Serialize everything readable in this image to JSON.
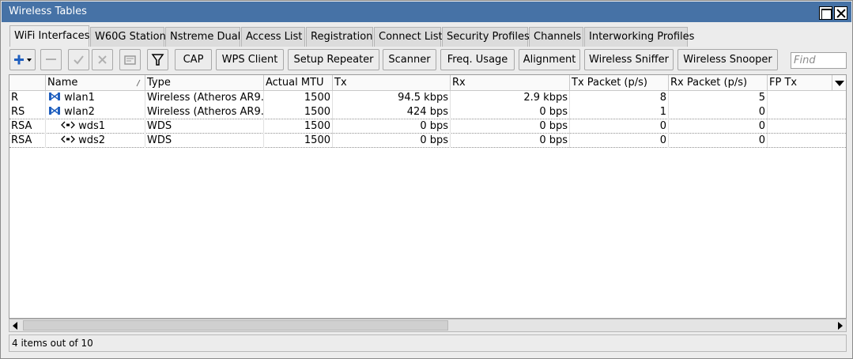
{
  "window": {
    "title": "Wireless Tables"
  },
  "tabs": [
    {
      "label": "WiFi Interfaces",
      "active": true
    },
    {
      "label": "W60G Station"
    },
    {
      "label": "Nstreme Dual"
    },
    {
      "label": "Access List"
    },
    {
      "label": "Registration"
    },
    {
      "label": "Connect List"
    },
    {
      "label": "Security Profiles"
    },
    {
      "label": "Channels"
    },
    {
      "label": "Interworking Profiles"
    }
  ],
  "toolbar": {
    "icons": {
      "add": "plus-icon",
      "remove": "minus-icon",
      "enable": "check-icon",
      "disable": "x-icon",
      "comment": "comment-icon",
      "filter": "filter-icon"
    },
    "buttons": [
      "CAP",
      "WPS Client",
      "Setup Repeater",
      "Scanner",
      "Freq. Usage",
      "Alignment",
      "Wireless Sniffer",
      "Wireless Snooper"
    ],
    "find_placeholder": "Find"
  },
  "table": {
    "columns": [
      "",
      "Name",
      "Type",
      "Actual MTU",
      "Tx",
      "Rx",
      "Tx Packet (p/s)",
      "Rx Packet (p/s)",
      "FP Tx"
    ],
    "rows": [
      {
        "flags": "R",
        "name": "wlan1",
        "icon": "wireless-interface-icon",
        "type": "Wireless (Atheros AR9...",
        "mtu": "1500",
        "tx": "94.5 kbps",
        "rx": "2.9 kbps",
        "txp": "8",
        "rxp": "5",
        "fptx": ""
      },
      {
        "flags": "RS",
        "name": "wlan2",
        "icon": "wireless-interface-icon",
        "type": "Wireless (Atheros AR9...",
        "mtu": "1500",
        "tx": "424 bps",
        "rx": "0 bps",
        "txp": "1",
        "rxp": "0",
        "fptx": ""
      },
      {
        "flags": "RSA",
        "name": "wds1",
        "icon": "wds-link-icon",
        "type": "WDS",
        "mtu": "1500",
        "tx": "0 bps",
        "rx": "0 bps",
        "txp": "0",
        "rxp": "0",
        "fptx": ""
      },
      {
        "flags": "RSA",
        "name": "wds2",
        "icon": "wds-link-icon",
        "type": "WDS",
        "mtu": "1500",
        "tx": "0 bps",
        "rx": "0 bps",
        "txp": "0",
        "rxp": "0",
        "fptx": ""
      }
    ]
  },
  "status": {
    "text": "4 items out of 10"
  },
  "colors": {
    "titlebar": "#4672a6",
    "icon_blue": "#1f5fbf"
  }
}
